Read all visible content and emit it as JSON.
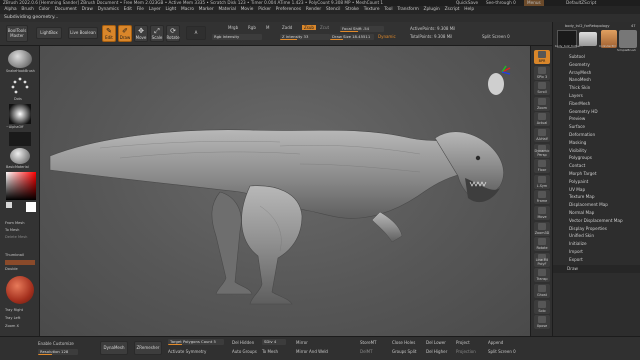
{
  "titlebar": {
    "text": "ZBrush 2022.0.6 [Hemming Sander]  ZBrush Document  • Free Mem 2.023GB • Active Mem 3335 • Scratch Disk 123 • Timer 0.004 ATime 1.423 • PolyCount 9.308 MP • MeshCount 1",
    "menus_label": "Menus",
    "default_script": "DefaultZScript",
    "quicksave": "QuickSave",
    "seethrough": "See-through 0"
  },
  "menubar": {
    "items": [
      "Alpha",
      "Brush",
      "Color",
      "Document",
      "Draw",
      "Dynamics",
      "Edit",
      "File",
      "Layer",
      "Light",
      "Macro",
      "Marker",
      "Material",
      "Movie",
      "Picker",
      "Preferences",
      "Render",
      "Stencil",
      "Stroke",
      "Texture",
      "Tool",
      "Transform",
      "Zplugin",
      "Zscript",
      "Help"
    ]
  },
  "status": {
    "text": "Subdividing geometry..."
  },
  "topshelf": {
    "buttons": {
      "boolean_master": "BoolTools Master",
      "lightbox": "LightBox",
      "live_boolean": "Live Boolean",
      "edit": "Edit",
      "draw": "Draw",
      "move": "Move",
      "scale": "Scale",
      "rotate": "Rotate"
    },
    "a_label": "A",
    "mrgb": "Mrgb",
    "rgb": "Rgb",
    "m": "M",
    "zadd": "Zadd",
    "zsub": "Zsub",
    "zcut": "Zcut",
    "rgb_intensity": "Rgb Intensity",
    "z_intensity": "Z Intensity 33",
    "focal_shift": "Focal Shift -54",
    "draw_size": "Draw Size 18.45511",
    "dynamic": "Dynamic",
    "active_points": "ActivePoints: 9.308 Mil",
    "total_points": "TotalPoints: 9.308 Mil",
    "split_screen": "Split Screen 0"
  },
  "leftshelf": {
    "brush_label": "SnakeHookBrush",
    "stroke_label": "Dots",
    "alpha_label": "~AlphaOff",
    "texture_label": "Texture Off",
    "material_label": "BasicMaterial",
    "from_mesh": "From Mesh",
    "to_mesh": "To Mesh",
    "delete_mesh": "Delete Mesh",
    "thumbnail": "Thumbnail",
    "double": "Double",
    "tray_right": "Tray Right",
    "tray_left": "Tray Left",
    "zoom_out": "Zoom X"
  },
  "rightshelf": {
    "buttons": [
      "BPR",
      "SPix 3",
      "Scroll",
      "Zoom",
      "Actual",
      "AAHalf",
      "Dynamic Persp",
      "Floor",
      "L.Sym",
      "Frame",
      "Move",
      "Zoom3D",
      "Rotate",
      "Line Fill PolyF",
      "Transp",
      "Ghost",
      "Solo",
      "Xpose"
    ]
  },
  "rightpanel": {
    "header_a": "body_tvl2_forRetopology",
    "header_b": "47",
    "poly_label": "PolyMesh3D",
    "cylinder_label": "Cylinder3D",
    "simple_label": "SimpleBrush",
    "body_label": "body_tvl2_forRet...",
    "subtool_items": [
      "Subtool",
      "Geometry",
      "ArrayMesh",
      "NanoMesh",
      "Thick Skin",
      "Layers",
      "FiberMesh",
      "Geometry HD",
      "Preview",
      "Surface",
      "Deformation",
      "Masking",
      "Visibility",
      "Polygroups",
      "Contact",
      "Morph Target",
      "Polypaint",
      "UV Map",
      "Texture Map",
      "Displacement Map",
      "Normal Map",
      "Vector Displacement Map",
      "Display Properties",
      "Unified Skin",
      "Initialize",
      "Import",
      "Export"
    ],
    "draw_label": "Draw"
  },
  "bottomshelf": {
    "enable_customize": "Enable Customize",
    "resolution": "Resolution 128",
    "dynamesh": "DynaMesh",
    "zremesher": "ZRemesher",
    "target_poly": "Target Polygons Count 5",
    "activate_symmetry": "Activate Symmetry",
    "del_hidden": "Del Hidden",
    "auto_groups": "Auto Groups",
    "sdiv": "SDiv 4",
    "to_mesh": "To Mesh",
    "mirror": "Mirror",
    "mirror_weld": "Mirror And Weld",
    "store_mt": "StoreMT",
    "del_mt": "DelMT",
    "close_holes": "Close Holes",
    "groups_split": "Groups Split",
    "del_lower": "Del Lower",
    "del_higher": "Del Higher",
    "project": "Project",
    "projection": "Projection",
    "append": "Append",
    "split_screen": "Split Screen 0"
  },
  "colors": {
    "accent": "#d9862a",
    "background": "#2b2b2b",
    "viewport": "#575757"
  }
}
